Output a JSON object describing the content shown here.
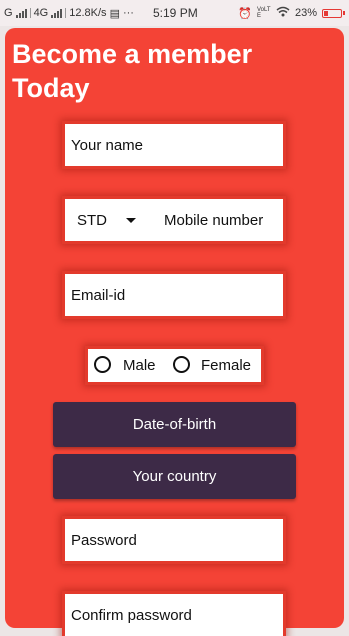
{
  "status_bar": {
    "carrier": "G",
    "network": "4G",
    "speed": "12.8K/s",
    "more": "···",
    "time": "5:19 PM",
    "volte": "VoLTE",
    "battery": "23%",
    "battery_level": 0.23
  },
  "form": {
    "title_line1": "Become a member",
    "title_line2": "Today",
    "name_placeholder": "Your name",
    "std_label": "STD",
    "mobile_placeholder": "Mobile number",
    "email_placeholder": "Email-id",
    "gender_options": [
      "Male",
      "Female"
    ],
    "dob_button": "Date-of-birth",
    "country_button": "Your country",
    "password_placeholder": "Password",
    "confirm_password_placeholder": "Confirm password"
  }
}
